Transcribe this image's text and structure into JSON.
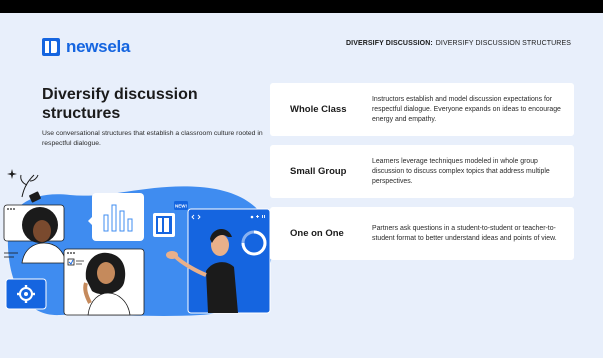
{
  "brand": {
    "name": "newsela",
    "accent": "#1565e0",
    "background": "#e8effb"
  },
  "breadcrumb": {
    "section": "DIVERSIFY DISCUSSION:",
    "page": "DIVERSIFY DISCUSSION STRUCTURES"
  },
  "heading": "Diversify discussion structures",
  "subheading": "Use conversational structures that establish a classroom culture rooted in respectful dialogue.",
  "illustration": {
    "badge": "NEW!"
  },
  "structures": [
    {
      "label": "Whole Class",
      "description": "Instructors establish and model discussion expectations for respectful dialogue. Everyone expands on ideas to encourage energy and empathy."
    },
    {
      "label": "Small Group",
      "description": "Learners leverage techniques modeled in whole group discussion to discuss complex topics that address multiple perspectives."
    },
    {
      "label": "One on One",
      "description": "Partners ask questions in a student-to-student or teacher-to-student format to better understand ideas and points of view."
    }
  ]
}
